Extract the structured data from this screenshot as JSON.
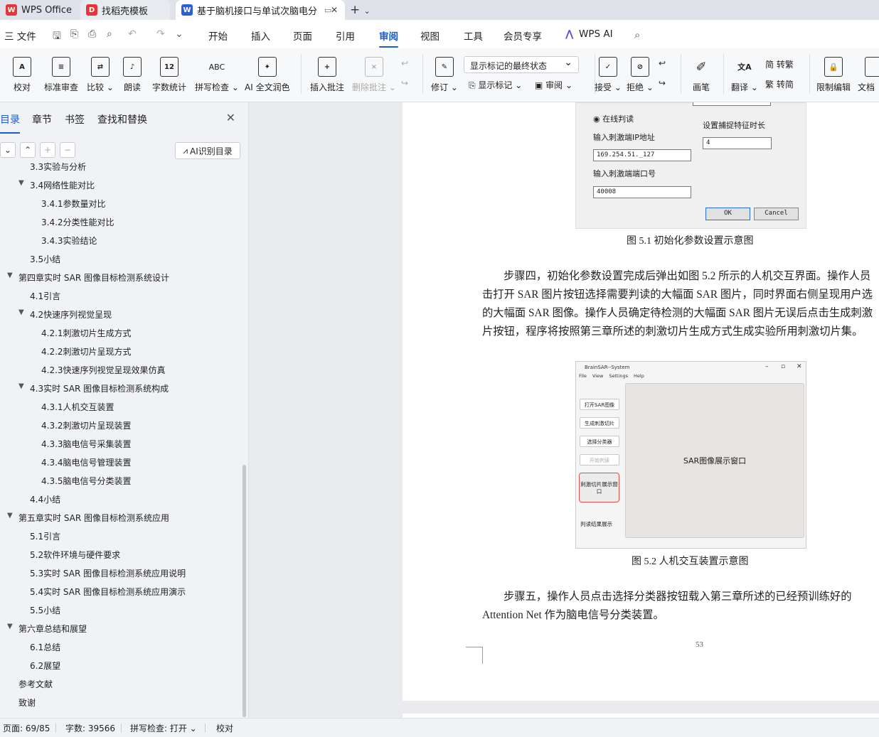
{
  "tabs": [
    {
      "label": "WPS Office",
      "icon": "wps-logo"
    },
    {
      "label": "找稻壳模板",
      "icon": "docer-logo"
    },
    {
      "label": "基于脑机接口与单试次脑电分",
      "icon": "word-doc-logo"
    }
  ],
  "menubar": {
    "file": "三 文件",
    "items": [
      "开始",
      "插入",
      "页面",
      "引用",
      "审阅",
      "视图",
      "工具",
      "会员专享",
      "WPS AI"
    ],
    "active": "审阅"
  },
  "toolbar": {
    "buttons": [
      {
        "label": "校对",
        "glyph": "A"
      },
      {
        "label": "标准审查",
        "glyph": "≡"
      },
      {
        "label": "比较",
        "glyph": "⇄"
      },
      {
        "label": "朗读",
        "glyph": "♪"
      },
      {
        "label": "字数统计",
        "glyph": "12"
      },
      {
        "label": "拼写检查",
        "glyph": "ABC"
      },
      {
        "label": "AI 全文润色",
        "glyph": "✦"
      },
      {
        "label": "插入批注",
        "glyph": "+"
      },
      {
        "label": "删除批注",
        "glyph": "×"
      },
      {
        "label": "修订",
        "glyph": "✎"
      },
      {
        "label": "接受",
        "glyph": "✓"
      },
      {
        "label": "拒绝",
        "glyph": "⊘"
      },
      {
        "label": "画笔",
        "glyph": "✐"
      },
      {
        "label": "翻译",
        "glyph": "文A"
      },
      {
        "label": "限制编辑",
        "glyph": "🔒"
      },
      {
        "label": "文档"
      }
    ],
    "markup_select": "显示标记的最终状态",
    "show_markup": "显示标记",
    "review": "审阅",
    "to_traditional": "简 转繁",
    "to_simplified": "繁 转简"
  },
  "sidebar": {
    "tabs": [
      "目录",
      "章节",
      "书签",
      "查找和替换"
    ],
    "active_tab": "目录",
    "ai_button": "AI识别目录",
    "toc": [
      {
        "label": "3.3实验与分析",
        "level": 2
      },
      {
        "label": "3.4网络性能对比",
        "level": 2,
        "expanded": true
      },
      {
        "label": "3.4.1参数量对比",
        "level": 3
      },
      {
        "label": "3.4.2分类性能对比",
        "level": 3
      },
      {
        "label": "3.4.3实验结论",
        "level": 3
      },
      {
        "label": "3.5小结",
        "level": 2
      },
      {
        "label": "第四章实时 SAR 图像目标检测系统设计",
        "level": 1,
        "expanded": true
      },
      {
        "label": "4.1引言",
        "level": 2
      },
      {
        "label": "4.2快速序列视觉呈现",
        "level": 2,
        "expanded": true
      },
      {
        "label": "4.2.1刺激切片生成方式",
        "level": 3
      },
      {
        "label": "4.2.2刺激切片呈现方式",
        "level": 3
      },
      {
        "label": "4.2.3快速序列视觉呈现效果仿真",
        "level": 3
      },
      {
        "label": "4.3实时 SAR 图像目标检测系统构成",
        "level": 2,
        "expanded": true
      },
      {
        "label": "4.3.1人机交互装置",
        "level": 3
      },
      {
        "label": "4.3.2刺激切片呈现装置",
        "level": 3
      },
      {
        "label": "4.3.3脑电信号采集装置",
        "level": 3
      },
      {
        "label": "4.3.4脑电信号管理装置",
        "level": 3
      },
      {
        "label": "4.3.5脑电信号分类装置",
        "level": 3
      },
      {
        "label": "4.4小结",
        "level": 2
      },
      {
        "label": "第五章实时 SAR 图像目标检测系统应用",
        "level": 1,
        "expanded": true
      },
      {
        "label": "5.1引言",
        "level": 2
      },
      {
        "label": "5.2软件环境与硬件要求",
        "level": 2
      },
      {
        "label": "5.3实时 SAR 图像目标检测系统应用说明",
        "level": 2
      },
      {
        "label": "5.4实时 SAR 图像目标检测系统应用演示",
        "level": 2
      },
      {
        "label": "5.5小结",
        "level": 2
      },
      {
        "label": "第六章总结和展望",
        "level": 1,
        "expanded": true
      },
      {
        "label": "6.1总结",
        "level": 2
      },
      {
        "label": "6.2展望",
        "level": 2
      },
      {
        "label": "参考文献",
        "level": 1
      },
      {
        "label": "致谢",
        "level": 1
      }
    ]
  },
  "document": {
    "fig1": {
      "radio_label": "在线判读",
      "ip_label": "输入刺激端IP地址",
      "ip_value": "169.254.51._127",
      "port_label": "输入刺激端端口号",
      "port_value": "40008",
      "capture_label": "设置捕捉特征时长",
      "capture_value": "4",
      "ok": "OK",
      "cancel": "Cancel",
      "caption": "图 5.1  初始化参数设置示意图"
    },
    "para1": [
      "步骤四，初始化参数设置完成后弹出如图 5.2 所示的人机交互界面。操作人员",
      "击打开 SAR 图片按钮选择需要判读的大幅面 SAR 图片，同时界面右侧呈现用户选",
      "的大幅面 SAR 图像。操作人员确定待检测的大幅面 SAR 图片无误后点击生成刺激",
      "片按钮，程序将按照第三章所述的刺激切片生成方式生成实验所用刺激切片集。"
    ],
    "fig2": {
      "window_title": "BrainSAR--System",
      "menu": [
        "File",
        "View",
        "Settings",
        "Help"
      ],
      "buttons": [
        "打开SAR图像",
        "生成刺激切片",
        "选择分类器",
        "开始判读"
      ],
      "stim_window": "刺激切片展示窗口",
      "result_label": "判读结果展示",
      "panel_label": "SAR图像展示窗口",
      "caption": "图 5.2  人机交互装置示意图"
    },
    "para2": [
      "步骤五，操作人员点击选择分类器按钮载入第三章所述的已经预训练好的",
      "Attention Net 作为脑电信号分类装置。"
    ],
    "page_number": "53"
  },
  "status": {
    "page": "页面: 69/85",
    "words": "字数: 39566",
    "spell": "拼写检查: 打开",
    "proof": "校对"
  },
  "colors": {
    "accent": "#1a5bd6",
    "wps_red": "#e8353a",
    "highlight_red": "#e04b4b"
  }
}
